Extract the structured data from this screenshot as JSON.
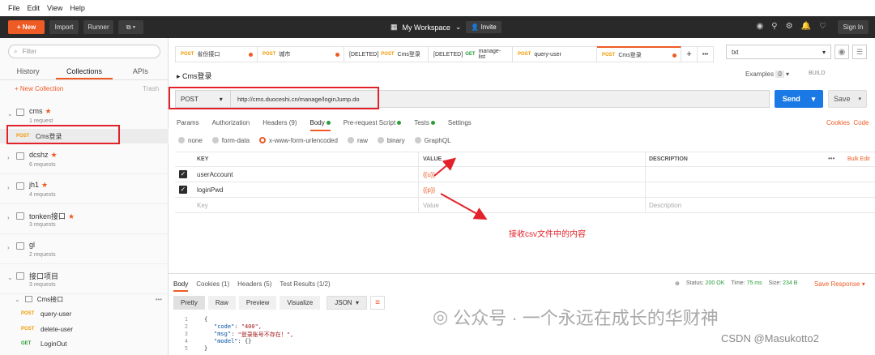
{
  "menu": [
    "File",
    "Edit",
    "View",
    "Help"
  ],
  "toolbar": {
    "new": "New",
    "import": "Import",
    "runner": "Runner",
    "workspace": "My Workspace",
    "invite": "Invite",
    "signin": "Sign In"
  },
  "sidebar": {
    "filter_placeholder": "Filter",
    "tabs": [
      "History",
      "Collections",
      "APIs"
    ],
    "new_collection": "+ New Collection",
    "trash": "Trash",
    "collections": [
      {
        "name": "cms",
        "star": true,
        "requests": "1 request"
      },
      {
        "name": "dcshz",
        "star": true,
        "requests": "6 requests"
      },
      {
        "name": "jh1",
        "star": true,
        "requests": "4 requests"
      },
      {
        "name": "tonken接口",
        "star": true,
        "requests": "3 requests"
      },
      {
        "name": "gl",
        "star": false,
        "requests": "2 requests"
      },
      {
        "name": "接口项目",
        "star": false,
        "requests": "3 requests"
      }
    ],
    "cms_request": {
      "method": "POST",
      "name": "Cms登录"
    },
    "subfolder": "Cms接口",
    "sub_requests": [
      {
        "method": "POST",
        "name": "query-user"
      },
      {
        "method": "POST",
        "name": "delete-user"
      },
      {
        "method": "GET",
        "name": "LoginOut"
      }
    ]
  },
  "tabs": [
    {
      "prefix": "",
      "method": "POST",
      "name": "省份接口"
    },
    {
      "prefix": "",
      "method": "POST",
      "name": "城市"
    },
    {
      "prefix": "[DELETED]",
      "method": "POST",
      "name": "Cms登录"
    },
    {
      "prefix": "[DELETED]",
      "method": "GET",
      "name": "manage-list"
    },
    {
      "prefix": "",
      "method": "POST",
      "name": "query-user"
    },
    {
      "prefix": "",
      "method": "POST",
      "name": "Cms登录"
    }
  ],
  "env": "txt",
  "request": {
    "title": "Cms登录",
    "examples": "Examples",
    "examples_count": "0",
    "build": "BUILD",
    "method": "POST",
    "url": "http://cms.duoceshi.cn/manage/loginJump.do",
    "send": "Send",
    "save": "Save"
  },
  "subtabs": [
    "Params",
    "Authorization",
    "Headers (9)",
    "Body",
    "Pre-request Script",
    "Tests",
    "Settings"
  ],
  "cookies": "Cookies",
  "code": "Code",
  "body_modes": [
    "none",
    "form-data",
    "x-www-form-urlencoded",
    "raw",
    "binary",
    "GraphQL"
  ],
  "params": {
    "headers": [
      "KEY",
      "VALUE",
      "DESCRIPTION"
    ],
    "bulk_edit": "Bulk Edit",
    "rows": [
      {
        "key": "userAccount",
        "value": "{{u}}",
        "desc": ""
      },
      {
        "key": "loginPwd",
        "value": "{{p}}",
        "desc": ""
      }
    ],
    "placeholder": {
      "key": "Key",
      "value": "Value",
      "desc": "Description"
    }
  },
  "annotation": "接收csv文件中的内容",
  "response": {
    "tabs": [
      "Body",
      "Cookies (1)",
      "Headers (5)",
      "Test Results (1/2)"
    ],
    "status_label": "Status:",
    "status": "200 OK",
    "time_label": "Time:",
    "time": "75 ms",
    "size_label": "Size:",
    "size": "234 B",
    "save": "Save Response",
    "formats": [
      "Pretty",
      "Raw",
      "Preview",
      "Visualize"
    ],
    "lang": "JSON",
    "lines": [
      {
        "n": "1",
        "text": "{"
      },
      {
        "n": "2",
        "key": "\"code\"",
        "val": "\"400\","
      },
      {
        "n": "3",
        "key": "\"msg\"",
        "val": "\"登录账号不存在！\","
      },
      {
        "n": "4",
        "key": "\"model\"",
        "val": "{}"
      },
      {
        "n": "5",
        "text": "}"
      }
    ]
  },
  "watermark": "公众号 · 一个永远在成长的华财神",
  "csdn": "CSDN @Masukotto2"
}
